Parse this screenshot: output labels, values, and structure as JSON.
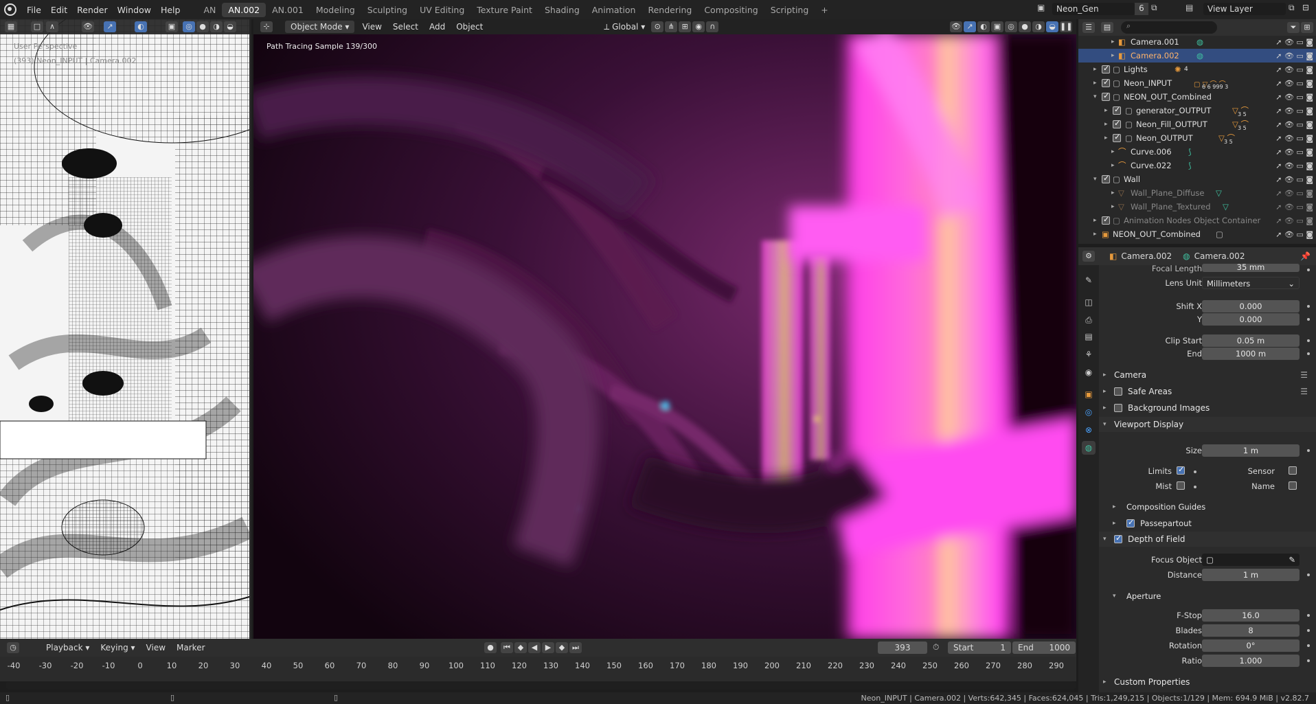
{
  "topbar": {
    "menus": [
      "File",
      "Edit",
      "Render",
      "Window",
      "Help"
    ],
    "tabs": [
      "AN",
      "AN.002",
      "AN.001",
      "Modeling",
      "Sculpting",
      "UV Editing",
      "Texture Paint",
      "Shading",
      "Animation",
      "Rendering",
      "Compositing",
      "Scripting"
    ],
    "active_tab": "AN.002",
    "add_tab": "+",
    "scene_name": "Neon_Gen",
    "scene_count": "6",
    "view_layer": "View Layer"
  },
  "left_viewport": {
    "perspective": "User Perspective",
    "object_info": "(393) Neon_INPUT | Camera.002"
  },
  "main_viewport": {
    "mode": "Object Mode",
    "menus": [
      "View",
      "Select",
      "Add",
      "Object"
    ],
    "transform": "Global",
    "render_status": "Path Tracing Sample 139/300"
  },
  "outliner": {
    "search_placeholder": "",
    "rows": [
      {
        "label": "Camera.001"
      },
      {
        "label": "Camera.002"
      },
      {
        "label": "Lights",
        "badge": "4"
      },
      {
        "label": "Neon_INPUT",
        "badge": "6 6 999 3"
      },
      {
        "label": "NEON_OUT_Combined"
      },
      {
        "label": "generator_OUTPUT",
        "badge": "3 5"
      },
      {
        "label": "Neon_Fill_OUTPUT",
        "badge": "3 5"
      },
      {
        "label": "Neon_OUTPUT",
        "badge": "3 5"
      },
      {
        "label": "Curve.006"
      },
      {
        "label": "Curve.022"
      },
      {
        "label": "Wall"
      },
      {
        "label": "Wall_Plane_Diffuse"
      },
      {
        "label": "Wall_Plane_Textured"
      },
      {
        "label": "Animation Nodes Object Container"
      },
      {
        "label": "NEON_OUT_Combined"
      }
    ]
  },
  "properties": {
    "breadcrumb_object": "Camera.002",
    "breadcrumb_data": "Camera.002",
    "focal_length_label": "Focal Length",
    "focal_length": "35 mm",
    "lens_unit_label": "Lens Unit",
    "lens_unit": "Millimeters",
    "shift_x_label": "Shift X",
    "shift_x": "0.000",
    "shift_y_label": "Y",
    "shift_y": "0.000",
    "clip_start_label": "Clip Start",
    "clip_start": "0.05 m",
    "clip_end_label": "End",
    "clip_end": "1000 m",
    "panel_camera": "Camera",
    "panel_safe_areas": "Safe Areas",
    "panel_background_images": "Background Images",
    "panel_viewport_display": "Viewport Display",
    "size_label": "Size",
    "size": "1 m",
    "limits_label": "Limits",
    "sensor_label": "Sensor",
    "mist_label": "Mist",
    "name_label": "Name",
    "panel_composition_guides": "Composition Guides",
    "panel_passepartout": "Passepartout",
    "panel_dof": "Depth of Field",
    "focus_object_label": "Focus Object",
    "distance_label": "Distance",
    "distance": "1 m",
    "panel_aperture": "Aperture",
    "fstop_label": "F-Stop",
    "fstop": "16.0",
    "blades_label": "Blades",
    "blades": "8",
    "rotation_label": "Rotation",
    "rotation": "0°",
    "ratio_label": "Ratio",
    "ratio": "1.000",
    "panel_custom_properties": "Custom Properties"
  },
  "timeline": {
    "menus": [
      "Playback",
      "Keying",
      "View",
      "Marker"
    ],
    "current_frame": "393",
    "start_label": "Start",
    "start": "1",
    "end_label": "End",
    "end": "1000",
    "ticks": [
      "-40",
      "-30",
      "-20",
      "-10",
      "0",
      "10",
      "20",
      "30",
      "40",
      "50",
      "60",
      "70",
      "80",
      "90",
      "100",
      "110",
      "120",
      "130",
      "140",
      "150",
      "160",
      "170",
      "180",
      "190",
      "200",
      "210",
      "220",
      "230",
      "240",
      "250",
      "260",
      "270",
      "280",
      "290"
    ]
  },
  "statusbar": {
    "text": "Neon_INPUT | Camera.002 | Verts:642,345 | Faces:624,045 | Tris:1,249,215 | Objects:1/129 | Mem: 694.9 MiB | v2.82.7"
  }
}
